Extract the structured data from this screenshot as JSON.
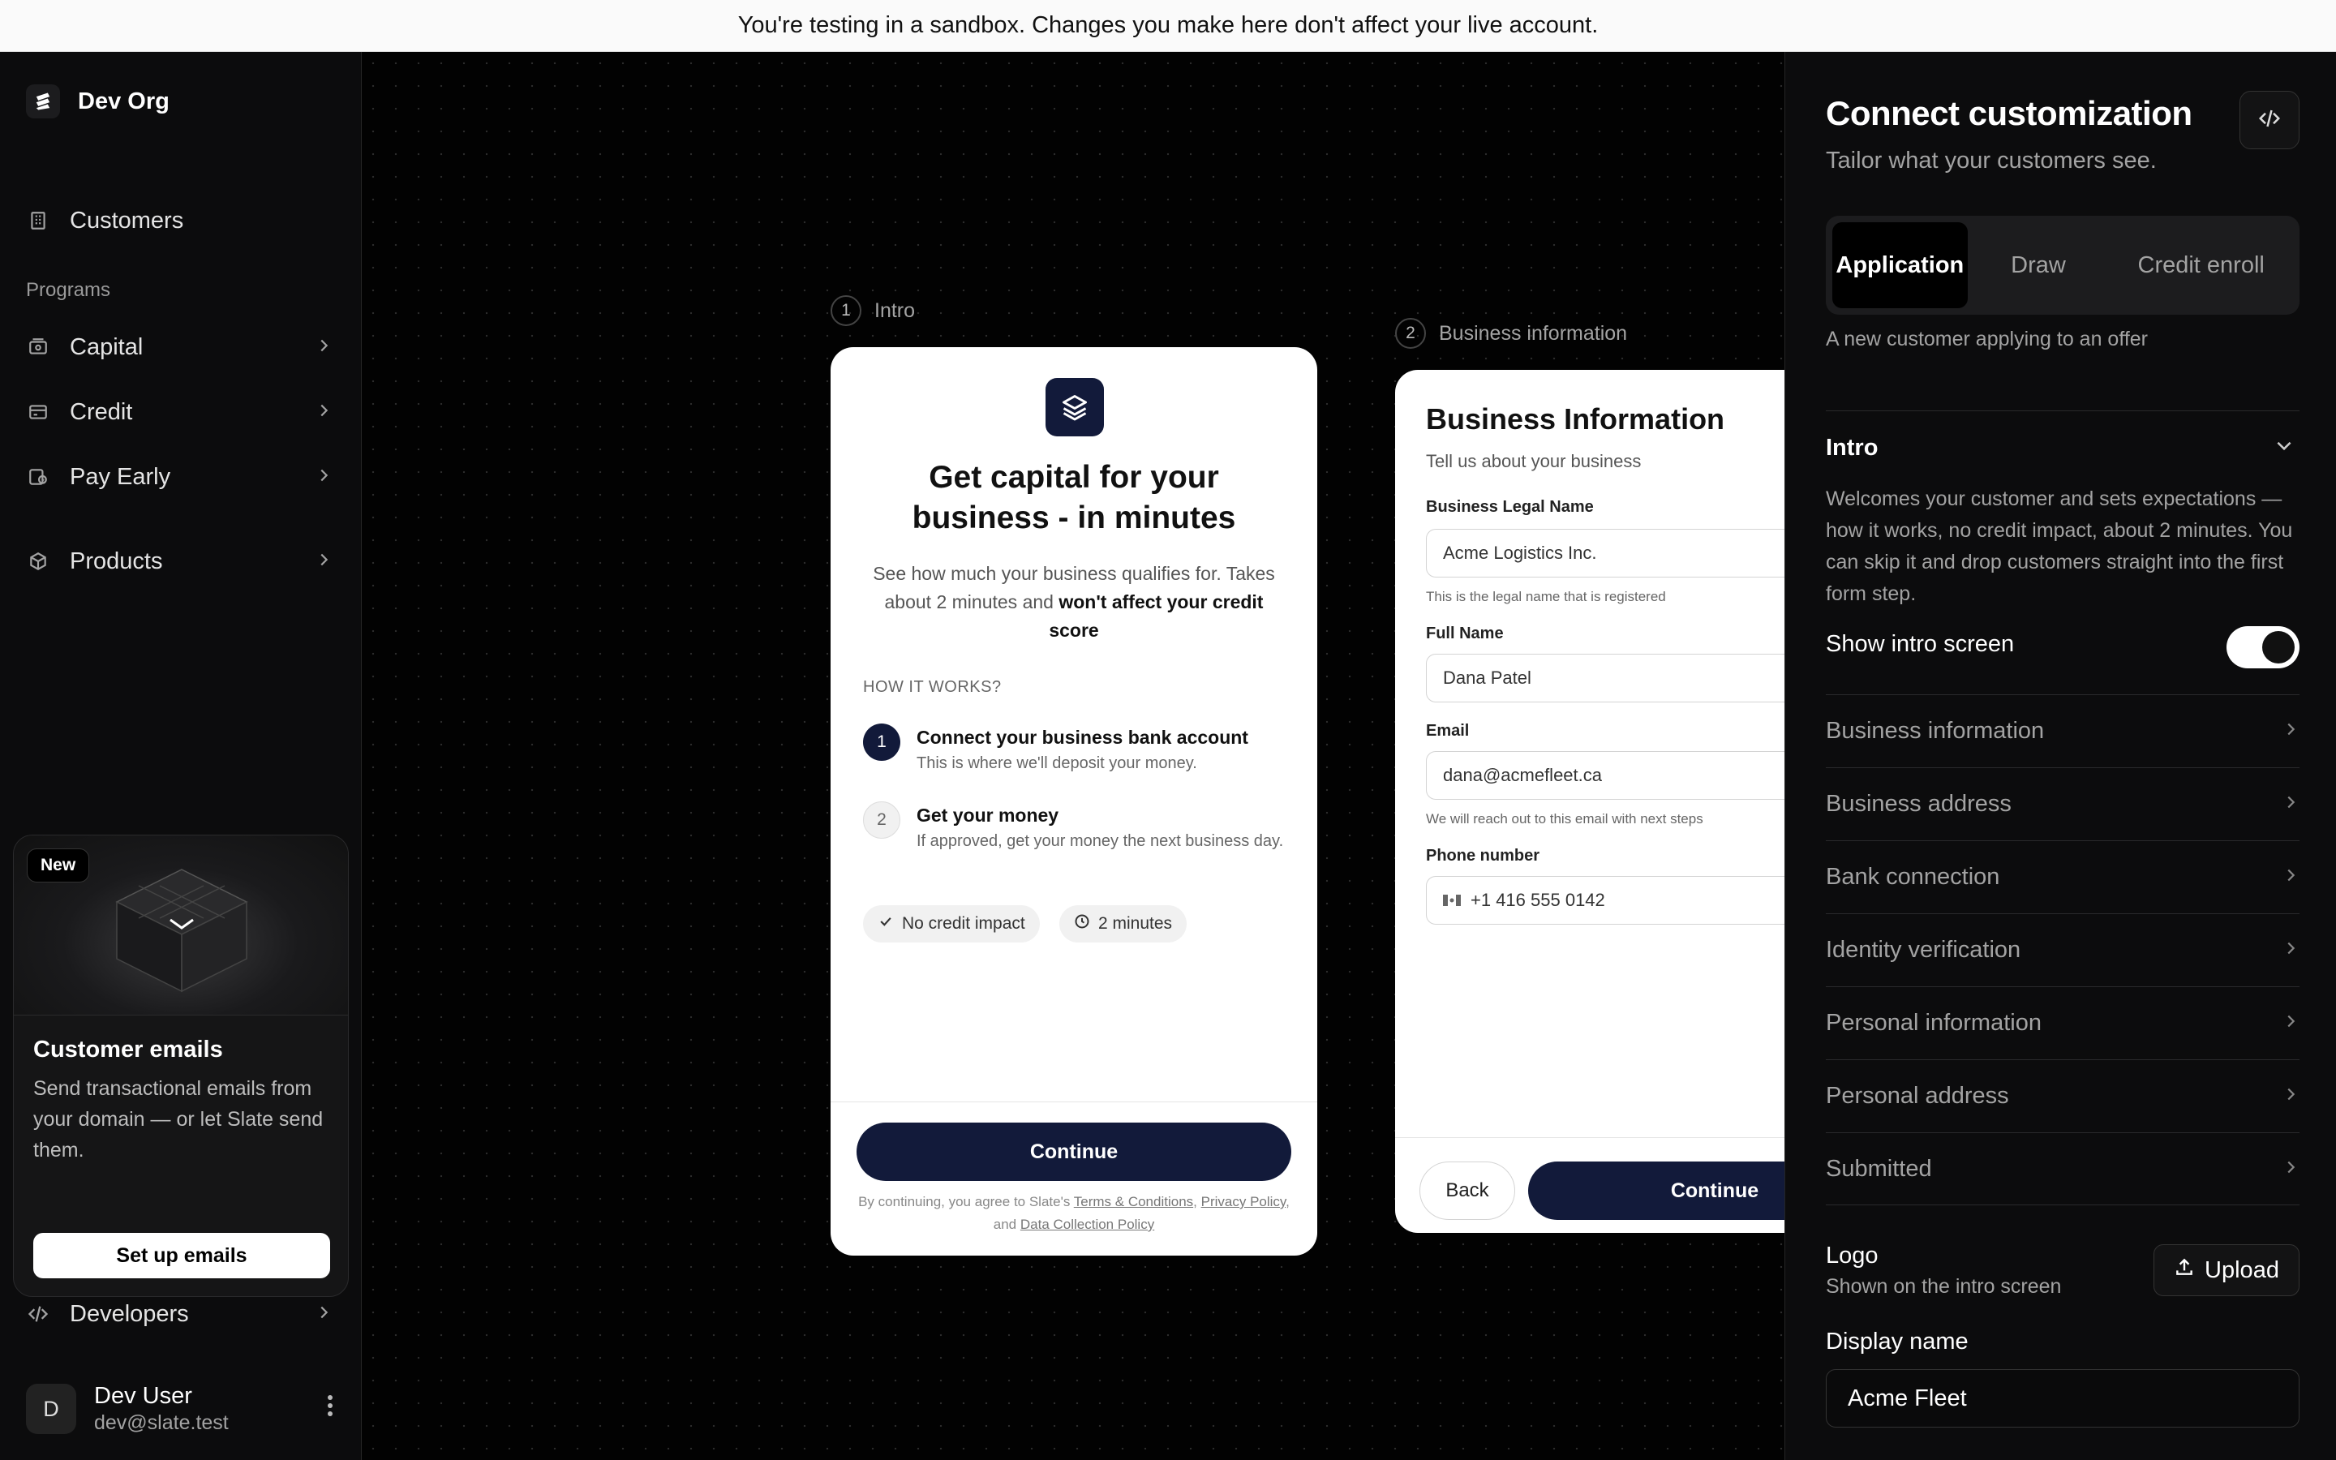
{
  "banner": {
    "text": "You're testing in a sandbox. Changes you make here don't affect your live account."
  },
  "sidebar": {
    "org_name": "Dev Org",
    "customers": "Customers",
    "programs_label": "Programs",
    "items": [
      {
        "label": "Capital",
        "icon": "capital-icon"
      },
      {
        "label": "Credit",
        "icon": "credit-card-icon"
      },
      {
        "label": "Pay Early",
        "icon": "pay-early-icon"
      },
      {
        "label": "Products",
        "icon": "package-icon"
      }
    ],
    "promo": {
      "badge": "New",
      "title": "Customer emails",
      "text": "Send transactional emails from your domain — or let Slate send them.",
      "button": "Set up emails"
    },
    "developers": "Developers",
    "user": {
      "initial": "D",
      "name": "Dev User",
      "email": "dev@slate.test"
    }
  },
  "canvas": {
    "step1": {
      "num": "1",
      "label": "Intro"
    },
    "step2": {
      "num": "2",
      "label": "Business information"
    },
    "intro_card": {
      "title": "Get capital for your business - in minutes",
      "subtitle_pre": "See how much your business qualifies for. Takes about 2 minutes and ",
      "subtitle_bold": "won't affect your credit score",
      "how_label": "HOW IT WORKS?",
      "steps": [
        {
          "num": "1",
          "title": "Connect your business bank account",
          "desc": "This is where we'll deposit your money."
        },
        {
          "num": "2",
          "title": "Get your money",
          "desc": "If approved, get your money the next business day."
        }
      ],
      "chips": [
        "No credit impact",
        "2 minutes"
      ],
      "continue": "Continue",
      "legal_pre": "By continuing, you agree to Slate's ",
      "legal_terms": "Terms & Conditions",
      "legal_mid": ", ",
      "legal_privacy": "Privacy Policy",
      "legal_and": ", and ",
      "legal_data": "Data Collection Policy"
    },
    "biz_card": {
      "title": "Business Information",
      "subtitle": "Tell us about your business",
      "legal_name_label": "Business Legal Name",
      "legal_name_value": "Acme Logistics Inc.",
      "legal_name_hint": "This is the legal name that is registered",
      "full_name_label": "Full Name",
      "full_name_value": "Dana Patel",
      "email_label": "Email",
      "email_value": "dana@acmefleet.ca",
      "email_hint": "We will reach out to this email with next steps",
      "phone_label": "Phone number",
      "phone_value": "+1 416 555 0142",
      "back": "Back",
      "continue": "Continue"
    }
  },
  "panel": {
    "title": "Connect customization",
    "subtitle": "Tailor what your customers see.",
    "tabs": [
      "Application",
      "Draw",
      "Credit enroll"
    ],
    "active_tab": "Application",
    "tab_desc": "A new customer applying to an offer",
    "intro": {
      "title": "Intro",
      "desc": "Welcomes your customer and sets expectations — how it works, no credit impact, about 2 minutes. You can skip it and drop customers straight into the first form step.",
      "toggle_label": "Show intro screen",
      "toggle_on": true
    },
    "sections": [
      "Business information",
      "Business address",
      "Bank connection",
      "Identity verification",
      "Personal information",
      "Personal address",
      "Submitted"
    ],
    "logo": {
      "label": "Logo",
      "sub": "Shown on the intro screen",
      "upload": "Upload"
    },
    "display_name": {
      "label": "Display name",
      "value": "Acme Fleet"
    }
  },
  "colors": {
    "brand_navy": "#121a3a",
    "banner_bg": "#fafafa"
  }
}
